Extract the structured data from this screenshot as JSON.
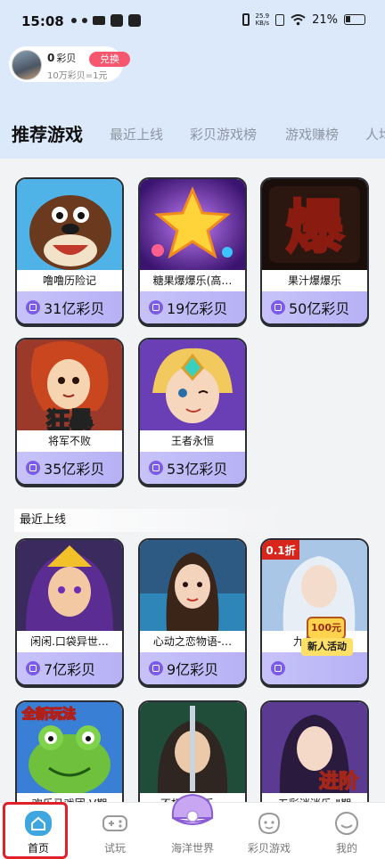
{
  "status_bar": {
    "time": "15:08",
    "net_speed_value": "25.9",
    "net_speed_unit": "KB/s",
    "battery": "21%"
  },
  "user": {
    "coins": "0",
    "coins_unit": "彩贝",
    "exchange_label": "兑换",
    "rate_text": "10万彩贝=1元"
  },
  "tabs": [
    {
      "label": "推荐游戏",
      "active": true
    },
    {
      "label": "最近上线",
      "active": false
    },
    {
      "label": "彩贝游戏榜",
      "active": false
    },
    {
      "label": "游戏赚榜",
      "active": false
    },
    {
      "label": "人均",
      "active": false
    }
  ],
  "recommended": [
    {
      "name": "噜噜历险记",
      "reward": "31亿彩贝"
    },
    {
      "name": "糖果爆爆乐(高…",
      "reward": "19亿彩贝"
    },
    {
      "name": "果汁爆爆乐",
      "reward": "50亿彩贝"
    },
    {
      "name": "将军不败",
      "reward": "35亿彩贝"
    },
    {
      "name": "王者永恒",
      "reward": "53亿彩贝"
    }
  ],
  "recent_section": {
    "title": "最近上线"
  },
  "recent": [
    {
      "name": "闲闲.口袋异世…",
      "reward": "7亿彩贝"
    },
    {
      "name": "心动之恋物语-…",
      "reward": "9亿彩贝"
    },
    {
      "name": "九州异…",
      "reward": "",
      "promo_top": "100元",
      "promo_bottom": "新人活动"
    },
    {
      "name": "欢乐马戏团-V期",
      "reward": ""
    },
    {
      "name": "不朽…爱乐…",
      "reward": ""
    },
    {
      "name": "五彩消消乐-Ⅱ期",
      "reward": ""
    }
  ],
  "card_badges": {
    "crazy_char": "爆",
    "crazy_char2": "狂暴",
    "discount": "0.1折",
    "new_play": "全新玩法",
    "advanced": "进阶"
  },
  "bottom_nav": [
    {
      "label": "首页",
      "icon": "home-icon",
      "active": true
    },
    {
      "label": "试玩",
      "icon": "gamepad-icon",
      "active": false
    },
    {
      "label": "海洋世界",
      "icon": "pearl-shell-icon",
      "active": false
    },
    {
      "label": "彩贝游戏",
      "icon": "shell-game-icon",
      "active": false
    },
    {
      "label": "我的",
      "icon": "profile-icon",
      "active": false
    }
  ],
  "colors": {
    "header_bg": "#dbe9fb",
    "reward_bg": "#c7c3f9",
    "exchange_btn": "#f6576e",
    "active_frame": "#e0202a"
  }
}
